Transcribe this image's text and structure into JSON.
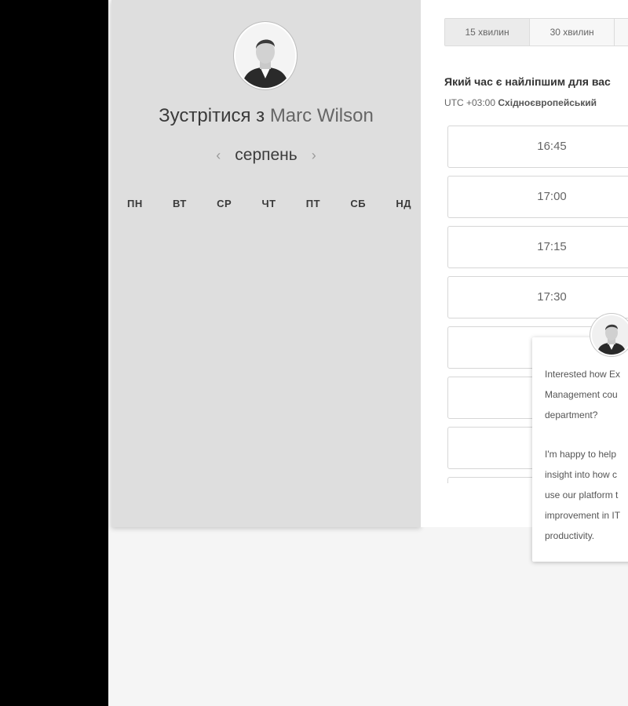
{
  "meeting": {
    "title_prefix": "Зустрітися з",
    "host_name": "Marc Wilson",
    "month": "серпень",
    "weekdays": [
      "ПН",
      "ВТ",
      "СР",
      "ЧТ",
      "ПТ",
      "СБ",
      "НД"
    ]
  },
  "booking": {
    "durations": [
      "15 хвилин",
      "30 хвилин",
      ""
    ],
    "question": "Який час є найліпшим для вас",
    "tz_prefix": "UTC +03:00",
    "tz_name": "Східноєвропейський",
    "slots": [
      "16:45",
      "17:00",
      "17:15",
      "17:30",
      "",
      "",
      "",
      ""
    ]
  },
  "chat": {
    "lines_1": [
      "Interested how Ex",
      "Management cou",
      "department?"
    ],
    "lines_2": [
      "I'm happy to help",
      "insight into how c",
      "use our platform t",
      "improvement in IT",
      "productivity."
    ]
  },
  "icons": {
    "prev": "chevron-left-icon",
    "next": "chevron-right-icon"
  }
}
